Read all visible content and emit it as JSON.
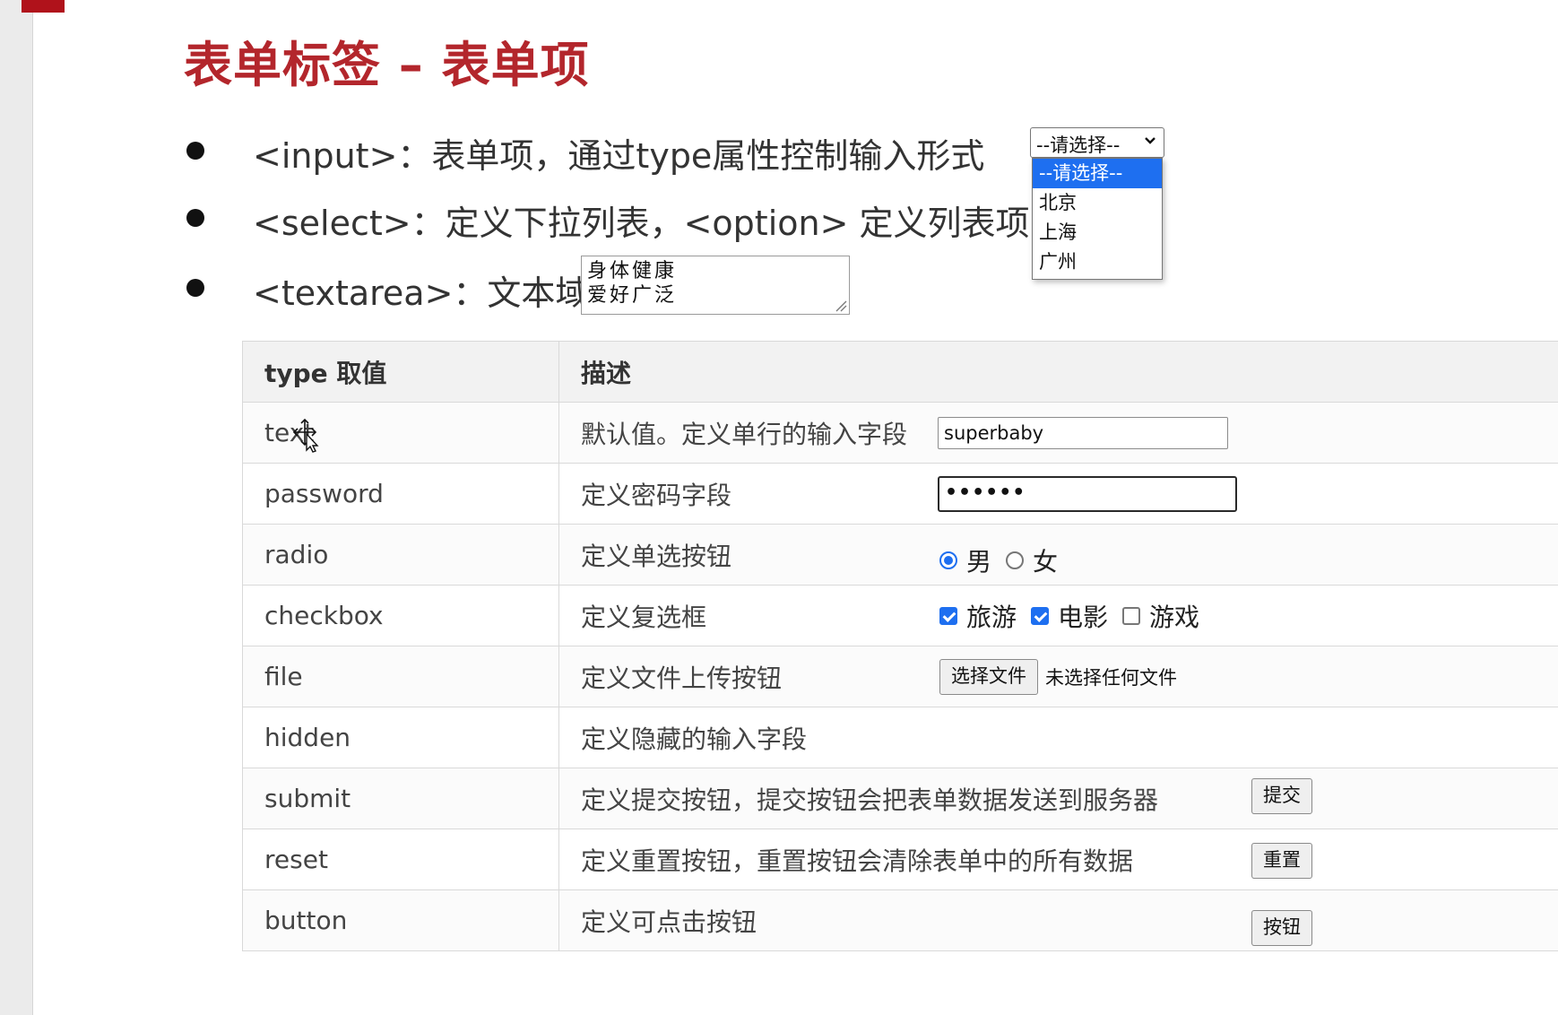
{
  "title": "表单标签 – 表单项",
  "bullets": [
    {
      "text": "<input>：表单项，通过type属性控制输入形式"
    },
    {
      "text": "<select>：定义下拉列表，<option> 定义列表项"
    },
    {
      "text": "<textarea>：文本域"
    }
  ],
  "textarea_demo": {
    "lines": [
      "身体健康",
      "爱好广泛"
    ]
  },
  "select_demo": {
    "current": "--请选择--",
    "options": [
      "--请选择--",
      "北京",
      "上海",
      "广州"
    ],
    "highlighted_index": 0
  },
  "table": {
    "headers": [
      "type 取值",
      "描述"
    ],
    "rows": [
      {
        "type": "text",
        "desc": "默认值。定义单行的输入字段",
        "demo_value": "superbaby"
      },
      {
        "type": "password",
        "desc": "定义密码字段",
        "demo_value": "••••••"
      },
      {
        "type": "radio",
        "desc": "定义单选按钮",
        "options": [
          {
            "label": "男",
            "checked": true
          },
          {
            "label": "女",
            "checked": false
          }
        ]
      },
      {
        "type": "checkbox",
        "desc": "定义复选框",
        "options": [
          {
            "label": "旅游",
            "checked": true
          },
          {
            "label": "电影",
            "checked": true
          },
          {
            "label": "游戏",
            "checked": false
          }
        ]
      },
      {
        "type": "file",
        "desc": "定义文件上传按钮",
        "button_label": "选择文件",
        "status": "未选择任何文件"
      },
      {
        "type": "hidden",
        "desc": "定义隐藏的输入字段"
      },
      {
        "type": "submit",
        "desc": "定义提交按钮，提交按钮会把表单数据发送到服务器",
        "button_label": "提交"
      },
      {
        "type": "reset",
        "desc": "定义重置按钮，重置按钮会清除表单中的所有数据",
        "button_label": "重置"
      },
      {
        "type": "button",
        "desc": "定义可点击按钮",
        "button_label": "按钮"
      }
    ]
  },
  "colors": {
    "title": "#b3262c",
    "accent": "#1e6ff0",
    "corner_mark": "#b0121b"
  },
  "icons": [
    "chevron-down-icon",
    "resize-grip-icon",
    "mouse-cursor-icon"
  ]
}
